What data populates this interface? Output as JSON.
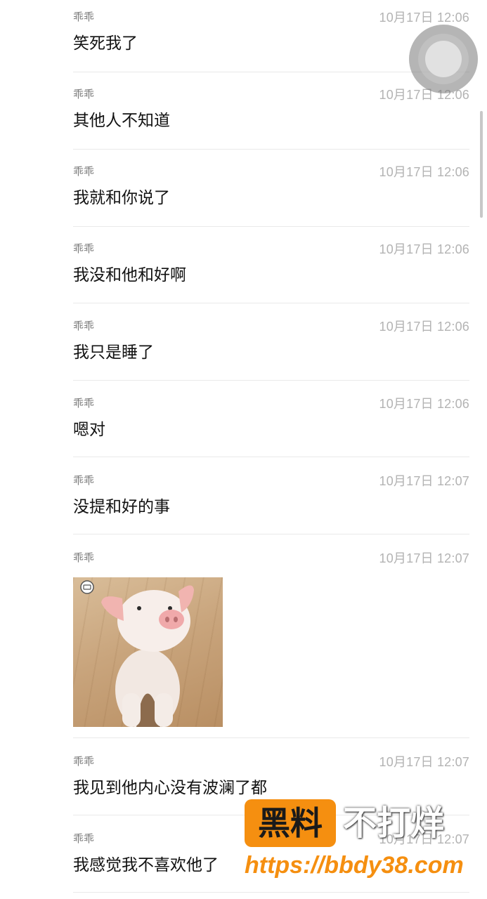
{
  "messages": [
    {
      "sender": "乖乖",
      "time": "10月17日 12:06",
      "text": "笑死我了"
    },
    {
      "sender": "乖乖",
      "time": "10月17日 12:06",
      "text": "其他人不知道"
    },
    {
      "sender": "乖乖",
      "time": "10月17日 12:06",
      "text": "我就和你说了"
    },
    {
      "sender": "乖乖",
      "time": "10月17日 12:06",
      "text": "我没和他和好啊"
    },
    {
      "sender": "乖乖",
      "time": "10月17日 12:06",
      "text": "我只是睡了"
    },
    {
      "sender": "乖乖",
      "time": "10月17日 12:06",
      "text": "嗯对"
    },
    {
      "sender": "乖乖",
      "time": "10月17日 12:07",
      "text": "没提和好的事"
    },
    {
      "sender": "乖乖",
      "time": "10月17日 12:07",
      "image": "pig-sticker"
    },
    {
      "sender": "乖乖",
      "time": "10月17日 12:07",
      "text": "我见到他内心没有波澜了都"
    },
    {
      "sender": "乖乖",
      "time": "10月17日 12:07",
      "text": "我感觉我不喜欢他了"
    }
  ],
  "watermark": {
    "badge": "黑料",
    "brand": "不打烊",
    "url": "https://bbdy38.com",
    "color": "#f58f10"
  },
  "colors": {
    "sender": "#7a7a7a",
    "time": "#b3b3b3",
    "text": "#111111",
    "divider": "#e9e9e9"
  }
}
